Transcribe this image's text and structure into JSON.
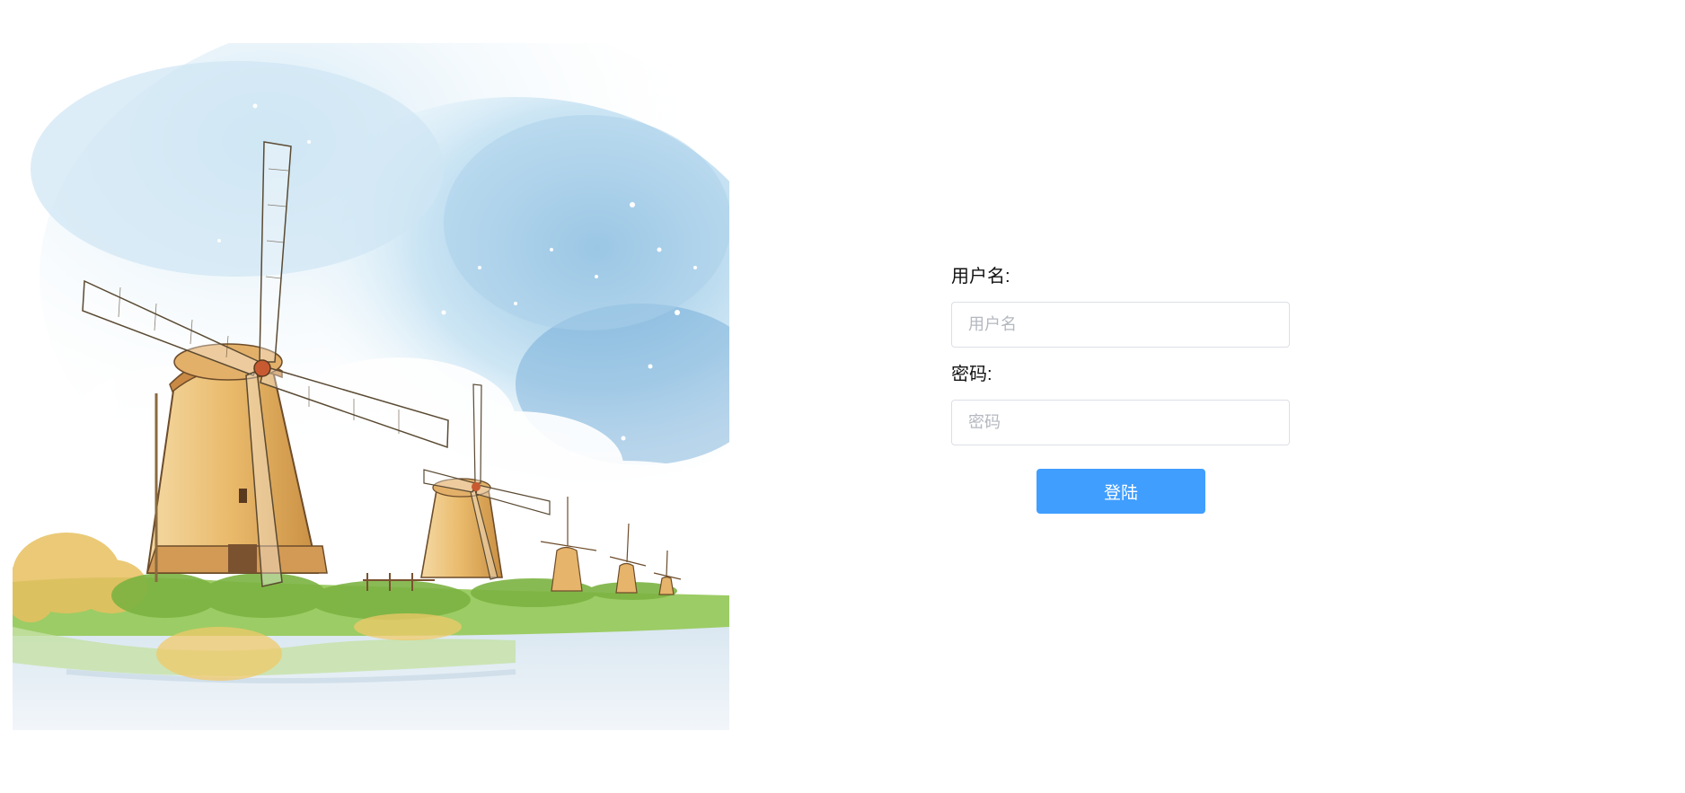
{
  "login": {
    "username_label": "用户名:",
    "username_placeholder": "用户名",
    "username_value": "",
    "password_label": "密码:",
    "password_placeholder": "密码",
    "password_value": "",
    "submit_label": "登陆"
  },
  "illustration": {
    "subject": "windmills-watercolor-image"
  },
  "colors": {
    "button": "#409eff",
    "input_border": "#dcdfe6",
    "placeholder": "#b4b8bf"
  }
}
